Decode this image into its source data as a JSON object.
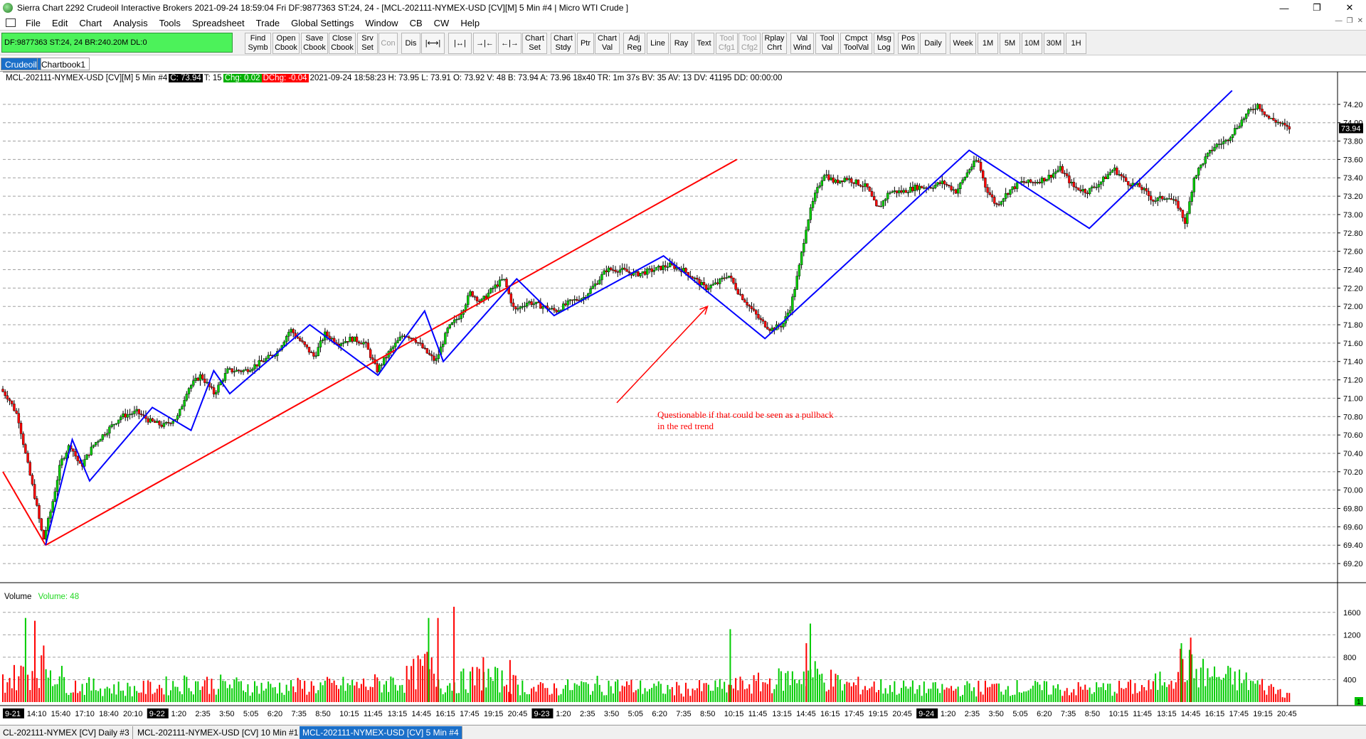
{
  "window": {
    "title": "Sierra Chart 2292 Crudeoil  Interactive Brokers 2021-09-24  18:59:04 Fri  DF:9877363  ST:24, 24 - [MCL-202111-NYMEX-USD [CV][M]  5 Min  #4 | Micro WTI Crude ]",
    "minimize": "—",
    "restore": "❐",
    "close": "✕"
  },
  "menu": [
    "File",
    "Edit",
    "Chart",
    "Analysis",
    "Tools",
    "Spreadsheet",
    "Trade",
    "Global Settings",
    "Window",
    "CB",
    "CW",
    "Help"
  ],
  "mdi_buttons": [
    "—",
    "❐",
    "✕"
  ],
  "toolbar": {
    "status": "DF:9877363  ST:24, 24  BR:240.20M  DL:0",
    "buttons": [
      {
        "label": "Find\nSymb"
      },
      {
        "label": "Open\nCbook"
      },
      {
        "label": "Save\nCbook"
      },
      {
        "label": "Close\nCbook"
      },
      {
        "label": "Srv\nSet"
      },
      {
        "label": "Con",
        "disabled": true
      },
      {
        "label": "Dis"
      },
      {
        "label": "|⟷|"
      },
      {
        "label": "|↔|"
      },
      {
        "label": "→|←"
      },
      {
        "label": "←|→"
      },
      {
        "label": "Chart\nSet"
      },
      {
        "label": "Chart\nStdy"
      },
      {
        "label": "Ptr"
      },
      {
        "label": "Chart\nVal"
      },
      {
        "label": "Adj\nReg"
      },
      {
        "label": "Line"
      },
      {
        "label": "Ray"
      },
      {
        "label": "Text"
      },
      {
        "label": "Tool\nCfg1",
        "disabled": true
      },
      {
        "label": "Tool\nCfg2",
        "disabled": true
      },
      {
        "label": "Rplay\nChrt"
      },
      {
        "label": "Val\nWind"
      },
      {
        "label": "Tool\nVal"
      },
      {
        "label": "Cmpct\nToolVal"
      },
      {
        "label": "Msg\nLog"
      },
      {
        "label": "Pos\nWin"
      },
      {
        "label": "Daily"
      },
      {
        "label": "Week"
      },
      {
        "label": "1M"
      },
      {
        "label": "5M"
      },
      {
        "label": "10M"
      },
      {
        "label": "30M"
      },
      {
        "label": "1H"
      }
    ]
  },
  "chartbook_tabs": [
    {
      "label": "Crudeoil",
      "active": true
    },
    {
      "label": "Chartbook1",
      "active": false
    }
  ],
  "chart_header": {
    "symbol": "MCL-202111-NYMEX-USD [CV][M]  5 Min",
    "num": "#4",
    "last": "C: 73.94",
    "ticks": "T: 15",
    "chg": "Chg: 0.02",
    "dchg": "DChg: -0.04",
    "rest": "2021-09-24 18:58:23 H: 73.95 L: 73.91 O: 73.92 V: 48 B: 73.94 A: 73.96 18x40 TR: 1m 37s BV: 35 AV: 13 DV: 41195 DD: 00:00:00"
  },
  "volume_label": {
    "name": "Volume",
    "value": "Volume: 48"
  },
  "annotation": [
    "Questionable if that could be seen as a pullback",
    "in the red trend"
  ],
  "colors": {
    "up_candle": "#00cc00",
    "down_candle": "#ff0000",
    "wick": "#000000",
    "trend_red": "#ff0000",
    "zigzag_blue": "#0000ff",
    "grid": "#a0a0a0",
    "price_tag_bg": "#000000"
  },
  "chart_data": {
    "type": "candlestick",
    "title": "MCL-202111-NYMEX-USD [CV][M] 5 Min",
    "ylim": [
      69.1,
      74.4
    ],
    "y_ticks": [
      69.2,
      69.4,
      69.6,
      69.8,
      70.0,
      70.2,
      70.4,
      70.6,
      70.8,
      71.0,
      71.2,
      71.4,
      71.6,
      71.8,
      72.0,
      72.2,
      72.4,
      72.6,
      72.8,
      73.0,
      73.2,
      73.4,
      73.6,
      73.8,
      74.0,
      74.2
    ],
    "y_tick_labels": [
      "69.20",
      "69.40",
      "69.60",
      "69.80",
      "70.00",
      "70.20",
      "70.40",
      "70.60",
      "70.80",
      "71.00",
      "71.20",
      "71.40",
      "71.60",
      "71.80",
      "72.00",
      "72.20",
      "72.40",
      "72.60",
      "72.80",
      "73.00",
      "73.20",
      "73.40",
      "73.60",
      "73.80",
      "74.00",
      "74.20"
    ],
    "last_price_label": "73.94",
    "last_price": 73.94,
    "volume_ylim": [
      0,
      1800
    ],
    "volume_ticks": [
      400,
      800,
      1200,
      1600
    ],
    "volume_tick_labels": [
      "400",
      "800",
      "1200",
      "1600"
    ],
    "volume_last_label": "1",
    "x_labels": [
      {
        "text": "9-21",
        "boxed": true
      },
      {
        "text": "14:10"
      },
      {
        "text": "15:40"
      },
      {
        "text": "17:10"
      },
      {
        "text": "18:40"
      },
      {
        "text": "20:10"
      },
      {
        "text": "9-22",
        "boxed": true
      },
      {
        "text": "1:20"
      },
      {
        "text": "2:35"
      },
      {
        "text": "3:50"
      },
      {
        "text": "5:05"
      },
      {
        "text": "6:20"
      },
      {
        "text": "7:35"
      },
      {
        "text": "8:50"
      },
      {
        "text": "10:15"
      },
      {
        "text": "11:45"
      },
      {
        "text": "13:15"
      },
      {
        "text": "14:45"
      },
      {
        "text": "16:15"
      },
      {
        "text": "17:45"
      },
      {
        "text": "19:15"
      },
      {
        "text": "20:45"
      },
      {
        "text": "9-23",
        "boxed": true
      },
      {
        "text": "1:20"
      },
      {
        "text": "2:35"
      },
      {
        "text": "3:50"
      },
      {
        "text": "5:05"
      },
      {
        "text": "6:20"
      },
      {
        "text": "7:35"
      },
      {
        "text": "8:50"
      },
      {
        "text": "10:15"
      },
      {
        "text": "11:45"
      },
      {
        "text": "13:15"
      },
      {
        "text": "14:45"
      },
      {
        "text": "16:15"
      },
      {
        "text": "17:45"
      },
      {
        "text": "19:15"
      },
      {
        "text": "20:45"
      },
      {
        "text": "9-24",
        "boxed": true
      },
      {
        "text": "1:20"
      },
      {
        "text": "2:35"
      },
      {
        "text": "3:50"
      },
      {
        "text": "5:05"
      },
      {
        "text": "6:20"
      },
      {
        "text": "7:35"
      },
      {
        "text": "8:50"
      },
      {
        "text": "10:15"
      },
      {
        "text": "11:45"
      },
      {
        "text": "13:15"
      },
      {
        "text": "14:45"
      },
      {
        "text": "16:15"
      },
      {
        "text": "17:45"
      },
      {
        "text": "19:15"
      },
      {
        "text": "20:45"
      }
    ],
    "price_path": [
      [
        0,
        71.1
      ],
      [
        0.6,
        71.0
      ],
      [
        1.3,
        70.8
      ],
      [
        2.0,
        70.3
      ],
      [
        2.6,
        69.9
      ],
      [
        3.2,
        69.45
      ],
      [
        3.8,
        69.8
      ],
      [
        4.5,
        70.3
      ],
      [
        5.2,
        70.5
      ],
      [
        6.0,
        70.25
      ],
      [
        7.0,
        70.5
      ],
      [
        8.0,
        70.65
      ],
      [
        9.0,
        70.8
      ],
      [
        10.2,
        70.85
      ],
      [
        11.2,
        70.75
      ],
      [
        12.2,
        70.7
      ],
      [
        13.3,
        70.8
      ],
      [
        14.0,
        71.1
      ],
      [
        15.0,
        71.25
      ],
      [
        16.0,
        71.05
      ],
      [
        17.0,
        71.3
      ],
      [
        18.3,
        71.3
      ],
      [
        19.6,
        71.4
      ],
      [
        20.7,
        71.5
      ],
      [
        21.7,
        71.75
      ],
      [
        22.6,
        71.6
      ],
      [
        23.5,
        71.45
      ],
      [
        24.3,
        71.7
      ],
      [
        25.3,
        71.6
      ],
      [
        26.3,
        71.65
      ],
      [
        27.3,
        71.6
      ],
      [
        28.2,
        71.3
      ],
      [
        29.1,
        71.5
      ],
      [
        30.2,
        71.7
      ],
      [
        31.0,
        71.65
      ],
      [
        31.9,
        71.5
      ],
      [
        32.6,
        71.4
      ],
      [
        33.5,
        71.75
      ],
      [
        34.4,
        71.9
      ],
      [
        35.2,
        72.15
      ],
      [
        36.0,
        72.05
      ],
      [
        36.9,
        72.2
      ],
      [
        37.7,
        72.3
      ],
      [
        38.5,
        71.95
      ],
      [
        39.5,
        72.05
      ],
      [
        40.6,
        72.0
      ],
      [
        41.6,
        71.95
      ],
      [
        42.7,
        72.05
      ],
      [
        43.7,
        72.1
      ],
      [
        44.6,
        72.25
      ],
      [
        45.4,
        72.4
      ],
      [
        46.4,
        72.4
      ],
      [
        47.6,
        72.35
      ],
      [
        49.0,
        72.4
      ],
      [
        50.1,
        72.45
      ],
      [
        51.1,
        72.4
      ],
      [
        52.0,
        72.3
      ],
      [
        52.8,
        72.2
      ],
      [
        53.7,
        72.25
      ],
      [
        54.5,
        72.35
      ],
      [
        55.3,
        72.15
      ],
      [
        56.1,
        72.0
      ],
      [
        56.9,
        71.85
      ],
      [
        57.7,
        71.75
      ],
      [
        58.6,
        71.8
      ],
      [
        59.2,
        72.0
      ],
      [
        59.8,
        72.4
      ],
      [
        60.4,
        72.9
      ],
      [
        61.0,
        73.2
      ],
      [
        61.7,
        73.45
      ],
      [
        62.5,
        73.35
      ],
      [
        63.3,
        73.4
      ],
      [
        64.1,
        73.35
      ],
      [
        64.9,
        73.3
      ],
      [
        65.7,
        73.05
      ],
      [
        66.6,
        73.25
      ],
      [
        67.6,
        73.25
      ],
      [
        68.6,
        73.3
      ],
      [
        69.6,
        73.3
      ],
      [
        70.6,
        73.35
      ],
      [
        71.6,
        73.25
      ],
      [
        72.6,
        73.5
      ],
      [
        73.2,
        73.6
      ],
      [
        73.8,
        73.3
      ],
      [
        74.6,
        73.1
      ],
      [
        75.5,
        73.25
      ],
      [
        76.4,
        73.35
      ],
      [
        77.4,
        73.35
      ],
      [
        78.4,
        73.4
      ],
      [
        79.4,
        73.5
      ],
      [
        80.4,
        73.3
      ],
      [
        81.4,
        73.25
      ],
      [
        82.4,
        73.35
      ],
      [
        83.4,
        73.5
      ],
      [
        84.4,
        73.35
      ],
      [
        85.4,
        73.3
      ],
      [
        86.4,
        73.15
      ],
      [
        87.4,
        73.2
      ],
      [
        88.2,
        73.1
      ],
      [
        88.8,
        72.9
      ],
      [
        89.4,
        73.4
      ],
      [
        90.2,
        73.6
      ],
      [
        91.0,
        73.75
      ],
      [
        91.8,
        73.8
      ],
      [
        92.6,
        73.95
      ],
      [
        93.4,
        74.1
      ],
      [
        94.2,
        74.2
      ],
      [
        95.0,
        74.05
      ],
      [
        95.8,
        74.0
      ],
      [
        96.4,
        73.94
      ]
    ],
    "volume_profile": [
      [
        0,
        500
      ],
      [
        2,
        700
      ],
      [
        3.2,
        900
      ],
      [
        5,
        400
      ],
      [
        10,
        300
      ],
      [
        14,
        450
      ],
      [
        20,
        350
      ],
      [
        27,
        400
      ],
      [
        30,
        500
      ],
      [
        31.8,
        850
      ],
      [
        33,
        400
      ],
      [
        36,
        600
      ],
      [
        40,
        300
      ],
      [
        45,
        400
      ],
      [
        50,
        300
      ],
      [
        54,
        350
      ],
      [
        57,
        450
      ],
      [
        59.5,
        600
      ],
      [
        60.5,
        700
      ],
      [
        63,
        400
      ],
      [
        70,
        300
      ],
      [
        75,
        350
      ],
      [
        80,
        300
      ],
      [
        86,
        350
      ],
      [
        88.4,
        900
      ],
      [
        89.5,
        700
      ],
      [
        91,
        600
      ],
      [
        93,
        500
      ],
      [
        96.4,
        200
      ]
    ],
    "volume_spikes": [
      [
        1.7,
        1500
      ],
      [
        2.4,
        1450
      ],
      [
        31.9,
        1500
      ],
      [
        32.6,
        1500
      ],
      [
        33.8,
        1700
      ],
      [
        36.0,
        800
      ],
      [
        38.0,
        750
      ],
      [
        54.5,
        1300
      ],
      [
        60.2,
        1050
      ],
      [
        60.5,
        1400
      ],
      [
        88.3,
        1050
      ],
      [
        89.0,
        1150
      ]
    ],
    "trendlines": {
      "red": [
        [
          [
            0.0,
            70.2
          ],
          [
            3.2,
            69.4
          ]
        ],
        [
          [
            3.2,
            69.4
          ],
          [
            55.0,
            73.6
          ]
        ]
      ],
      "blue": [
        [
          [
            3.2,
            69.4
          ],
          [
            5.2,
            70.55
          ],
          [
            6.5,
            70.1
          ],
          [
            11.2,
            70.9
          ],
          [
            14.1,
            70.65
          ],
          [
            15.8,
            71.3
          ],
          [
            17.0,
            71.05
          ],
          [
            23.0,
            71.8
          ],
          [
            28.1,
            71.25
          ],
          [
            31.6,
            71.95
          ],
          [
            33.0,
            71.4
          ],
          [
            38.5,
            72.3
          ],
          [
            41.3,
            71.9
          ],
          [
            49.5,
            72.55
          ],
          [
            57.1,
            71.65
          ],
          [
            72.4,
            73.7
          ],
          [
            81.4,
            72.85
          ],
          [
            92.1,
            74.35
          ]
        ]
      ],
      "red_arrow": [
        [
          46.0,
          70.95
        ],
        [
          52.8,
          72.0
        ]
      ]
    }
  },
  "chart_tabs": [
    {
      "label": "CL-202111-NYMEX [CV]  Daily  #3",
      "active": false
    },
    {
      "label": "MCL-202111-NYMEX-USD [CV]  10 Min  #1",
      "active": false
    },
    {
      "label": "MCL-202111-NYMEX-USD [CV]  5 Min  #4",
      "active": true
    }
  ]
}
